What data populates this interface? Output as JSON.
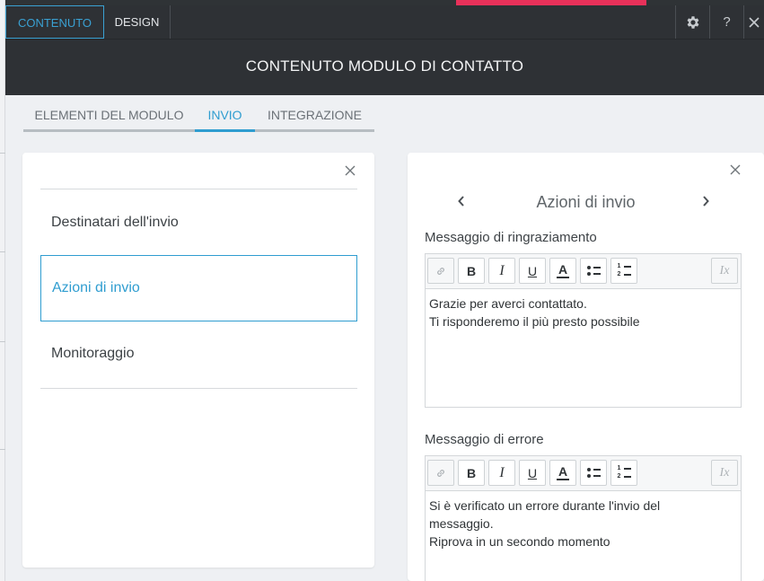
{
  "topbar": {
    "tabs": [
      {
        "label": "CONTENUTO",
        "active": true
      },
      {
        "label": "DESIGN",
        "active": false
      }
    ],
    "settings_icon": "gear-icon",
    "help_label": "?",
    "close_icon": "close-icon"
  },
  "header": {
    "title": "CONTENUTO MODULO DI CONTATTO"
  },
  "subtabs": [
    {
      "label": "ELEMENTI DEL MODULO",
      "active": false
    },
    {
      "label": "INVIO",
      "active": true
    },
    {
      "label": "INTEGRAZIONE",
      "active": false
    }
  ],
  "left_panel": {
    "items": [
      {
        "label": "Destinatari dell'invio",
        "active": false
      },
      {
        "label": "Azioni di invio",
        "active": true
      },
      {
        "label": "Monitoraggio",
        "active": false
      }
    ]
  },
  "right_panel": {
    "title": "Azioni di invio",
    "prev_icon": "chevron-left-icon",
    "next_icon": "chevron-right-icon",
    "thank_you": {
      "label": "Messaggio di ringraziamento",
      "lines": [
        "Grazie per averci contattato.",
        "Ti risponderemo il più presto possibile"
      ]
    },
    "error": {
      "label": "Messaggio di errore",
      "lines": [
        "Si è verificato un errore durante l'invio del",
        "messaggio.",
        "Riprova in un secondo momento"
      ]
    }
  },
  "toolbar_buttons": {
    "bold": "B",
    "italic": "I",
    "underline": "U",
    "text_color": "A",
    "clear_format": "Ix"
  },
  "colors": {
    "accent": "#2f9dd0",
    "dark_bar": "#2e3135",
    "pink": "#e8315a"
  }
}
